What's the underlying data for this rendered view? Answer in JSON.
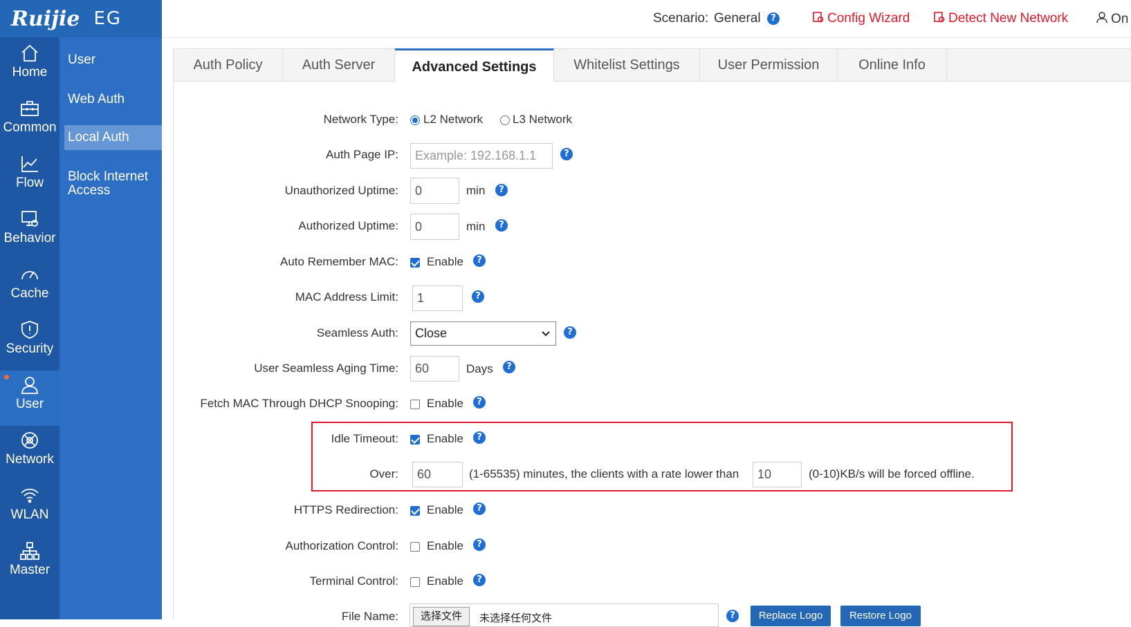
{
  "brand": {
    "logo_text": "Ruijie",
    "product": "EG"
  },
  "header": {
    "scenario_label": "Scenario:",
    "scenario_value": "General",
    "config_wizard": "Config Wizard",
    "detect_network": "Detect New Network",
    "user_menu": "On"
  },
  "nav": {
    "items": [
      {
        "label": "Home",
        "icon": "home-icon"
      },
      {
        "label": "Common",
        "icon": "toolbox-icon"
      },
      {
        "label": "Flow",
        "icon": "chart-line-icon"
      },
      {
        "label": "Behavior",
        "icon": "monitor-icon"
      },
      {
        "label": "Cache",
        "icon": "gauge-icon"
      },
      {
        "label": "Security",
        "icon": "shield-icon"
      },
      {
        "label": "User",
        "icon": "user-icon"
      },
      {
        "label": "Network",
        "icon": "globe-icon"
      },
      {
        "label": "WLAN",
        "icon": "wifi-icon"
      },
      {
        "label": "Master",
        "icon": "hierarchy-icon"
      }
    ],
    "active": "User"
  },
  "subnav": {
    "items": [
      "User",
      "Web Auth",
      "Local Auth",
      "Block Internet Access"
    ],
    "active": "Local Auth"
  },
  "tabs": [
    "Auth Policy",
    "Auth Server",
    "Advanced Settings",
    "Whitelist Settings",
    "User Permission",
    "Online Info"
  ],
  "active_tab": "Advanced Settings",
  "form": {
    "network_type": {
      "label": "Network Type:",
      "opt1": "L2 Network",
      "opt2": "L3 Network",
      "selected": "L2 Network"
    },
    "auth_page_ip": {
      "label": "Auth Page IP:",
      "placeholder": "Example: 192.168.1.1"
    },
    "unauth_uptime": {
      "label": "Unauthorized Uptime:",
      "value": "0",
      "unit": "min"
    },
    "auth_uptime": {
      "label": "Authorized Uptime:",
      "value": "0",
      "unit": "min"
    },
    "auto_remember_mac": {
      "label": "Auto Remember MAC:",
      "text": "Enable",
      "checked": true
    },
    "mac_limit": {
      "label": "MAC Address Limit:",
      "value": "1"
    },
    "seamless_auth": {
      "label": "Seamless Auth:",
      "value": "Close"
    },
    "seamless_aging": {
      "label": "User Seamless Aging Time:",
      "value": "60",
      "unit": "Days"
    },
    "dhcp_snooping": {
      "label": "Fetch MAC Through DHCP Snooping:",
      "text": "Enable",
      "checked": false
    },
    "idle_timeout": {
      "label": "Idle Timeout:",
      "text": "Enable",
      "checked": true
    },
    "over": {
      "label": "Over:",
      "minutes": "60",
      "mid_text": "(1-65535) minutes, the clients with a rate lower than",
      "rate": "10",
      "end_text": "(0-10)KB/s will be forced offline."
    },
    "https_redirect": {
      "label": "HTTPS Redirection:",
      "text": "Enable",
      "checked": true
    },
    "authz_control": {
      "label": "Authorization Control:",
      "text": "Enable",
      "checked": false
    },
    "terminal_control": {
      "label": "Terminal Control:",
      "text": "Enable",
      "checked": false
    },
    "file_name": {
      "label": "File Name:",
      "choose": "选择文件",
      "none": "未选择任何文件",
      "replace": "Replace Logo",
      "restore": "Restore Logo"
    }
  },
  "colors": {
    "nav_bg": "#1e57a3",
    "subnav_bg": "#2d6fc4",
    "accent": "#1f6ed4",
    "alert_red": "#e0192a",
    "highlight_box": "#e0192a"
  }
}
